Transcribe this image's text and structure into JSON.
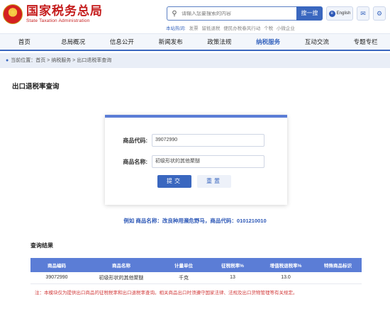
{
  "header": {
    "logo_cn": "国家税务总局",
    "logo_en": "State Taxation Administration",
    "search_placeholder": "请输入您要搜索的内容",
    "search_button": "搜一搜",
    "lang_label": "English",
    "hot_label": "本站热词:",
    "hot_words": [
      "发票",
      "留抵退税",
      "便民办税春风行动",
      "个税",
      "小微企业"
    ]
  },
  "nav": {
    "items": [
      "首页",
      "总局概况",
      "信息公开",
      "新闻发布",
      "政策法规",
      "纳税服务",
      "互动交流",
      "专题专栏"
    ],
    "active_index": 5
  },
  "breadcrumb": "当前位置：首页 > 纳税服务 > 出口退税率查询",
  "page_title": "出口退税率查询",
  "form": {
    "code_label": "商品代码:",
    "code_value": "39072990",
    "name_label": "商品名称:",
    "name_value": "初级形状的其他聚醚",
    "submit_label": "提交",
    "reset_label": "重置"
  },
  "example": "例如 商品名称：改良种用濒危野马，商品代码：0101210010",
  "results": {
    "title": "查询结果",
    "columns": [
      "商品编码",
      "商品名称",
      "计量单位",
      "征税税率%",
      "增值税退税率%",
      "特殊商品标识"
    ],
    "rows": [
      [
        "39072990",
        "初级形状的其他聚醚",
        "千克",
        "13",
        "13.0",
        ""
      ]
    ]
  },
  "note": "注：本模块仅为提供出口商品的征税税率和出口退税率查询。相关商品出口时须遵守国家法律、法规及出口货物管理等有关规定。"
}
